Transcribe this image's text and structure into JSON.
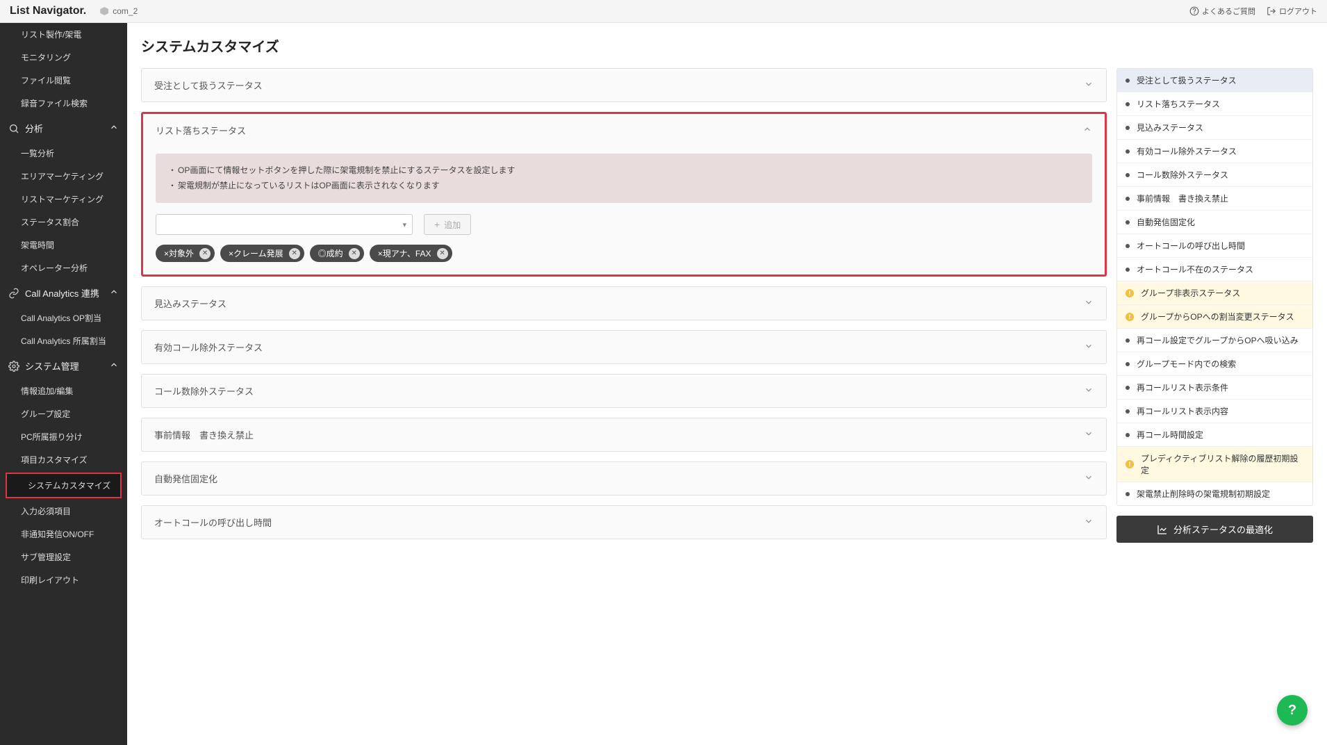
{
  "topbar": {
    "logo": "List Navigator.",
    "company": "com_2",
    "faq": "よくあるご質問",
    "logout": "ログアウト"
  },
  "sidebar": {
    "top_items": [
      "リスト製作/架電",
      "モニタリング",
      "ファイル閲覧",
      "録音ファイル検索"
    ],
    "sections": [
      {
        "label": "分析",
        "icon": "search",
        "items": [
          "一覧分析",
          "エリアマーケティング",
          "リストマーケティング",
          "ステータス割合",
          "架電時間",
          "オペレーター分析"
        ]
      },
      {
        "label": "Call Analytics 連携",
        "icon": "link",
        "items": [
          "Call Analytics OP割当",
          "Call Analytics 所属割当"
        ]
      },
      {
        "label": "システム管理",
        "icon": "gear",
        "items": [
          "情報追加/編集",
          "グループ設定",
          "PC所属振り分け",
          "項目カスタマイズ",
          "システムカスタマイズ",
          "入力必須項目",
          "非通知発信ON/OFF",
          "サブ管理設定",
          "印刷レイアウト"
        ],
        "active_index": 4
      }
    ]
  },
  "page": {
    "title": "システムカスタマイズ"
  },
  "panels": [
    {
      "title": "受注として扱うステータス",
      "expanded": false
    },
    {
      "title": "リスト落ちステータス",
      "expanded": true,
      "highlight": true,
      "info": [
        "OP画面にて情報セットボタンを押した際に架電規制を禁止にするステータスを設定します",
        "架電規制が禁止になっているリストはOP画面に表示されなくなります"
      ],
      "add_label": "追加",
      "chips": [
        "×対象外",
        "×クレーム発展",
        "◎成約",
        "×現アナ、FAX"
      ]
    },
    {
      "title": "見込みステータス",
      "expanded": false
    },
    {
      "title": "有効コール除外ステータス",
      "expanded": false
    },
    {
      "title": "コール数除外ステータス",
      "expanded": false
    },
    {
      "title": "事前情報　書き換え禁止",
      "expanded": false
    },
    {
      "title": "自動発信固定化",
      "expanded": false
    },
    {
      "title": "オートコールの呼び出し時間",
      "expanded": false
    }
  ],
  "right_nav": [
    {
      "label": "受注として扱うステータス",
      "state": "sel"
    },
    {
      "label": "リスト落ちステータス"
    },
    {
      "label": "見込みステータス"
    },
    {
      "label": "有効コール除外ステータス"
    },
    {
      "label": "コール数除外ステータス"
    },
    {
      "label": "事前情報　書き換え禁止"
    },
    {
      "label": "自動発信固定化"
    },
    {
      "label": "オートコールの呼び出し時間"
    },
    {
      "label": "オートコール不在のステータス"
    },
    {
      "label": "グループ非表示ステータス",
      "state": "warn"
    },
    {
      "label": "グループからOPへの割当変更ステータス",
      "state": "warn"
    },
    {
      "label": "再コール設定でグループからOPへ吸い込み"
    },
    {
      "label": "グループモード内での検索"
    },
    {
      "label": "再コールリスト表示条件"
    },
    {
      "label": "再コールリスト表示内容"
    },
    {
      "label": "再コール時間設定"
    },
    {
      "label": "プレディクティブリスト解除の履歴初期設定",
      "state": "warn"
    },
    {
      "label": "架電禁止削除時の架電規制初期設定"
    }
  ],
  "optimize_btn": "分析ステータスの最適化"
}
